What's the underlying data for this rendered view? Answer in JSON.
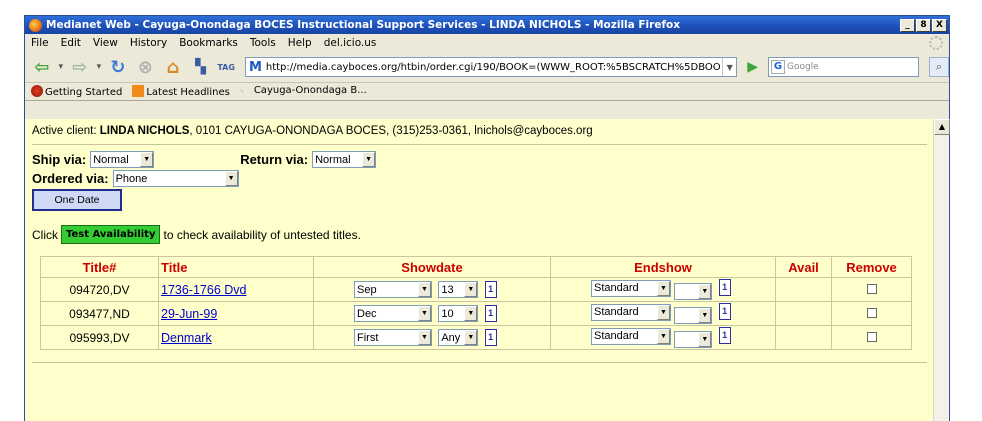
{
  "window": {
    "title": "Medianet Web - Cayuga-Onondaga BOCES Instructional Support Services - LINDA NICHOLS - Mozilla Firefox",
    "controls": [
      "_",
      "8",
      "X"
    ]
  },
  "menu": [
    "File",
    "Edit",
    "View",
    "History",
    "Bookmarks",
    "Tools",
    "Help",
    "del.icio.us"
  ],
  "nav": {
    "tag_label": "TAG",
    "url": "http://media.cayboces.org/htbin/order.cgi/190/BOOK=(WWW_ROOT:%5BSCRATCH%5DBOO",
    "search_placeholder": "Google"
  },
  "bookmarks": [
    "Getting Started",
    "Latest Headlines",
    "Cayuga-Onondaga B..."
  ],
  "client": {
    "prefix": "Active client: ",
    "name": "LINDA NICHOLS",
    "details": ", 0101 CAYUGA-ONONDAGA BOCES, (315)253-0361, lnichols@cayboces.org"
  },
  "form": {
    "ship_label": "Ship via:",
    "ship_value": "Normal",
    "return_label": "Return via:",
    "return_value": "Normal",
    "ordered_label": "Ordered via:",
    "ordered_value": "Phone",
    "one_date_button": "One Date",
    "click_prefix": "Click",
    "test_button": "Test Availability",
    "click_suffix": "to check availability of untested titles."
  },
  "table": {
    "headers": [
      "Title#",
      "Title",
      "Showdate",
      "Endshow",
      "Avail",
      "Remove"
    ],
    "rows": [
      {
        "num": "094720,DV",
        "title": "1736-1766 Dvd",
        "show_month": "Sep",
        "show_day": "13",
        "end_type": "Standard",
        "end_extra": ""
      },
      {
        "num": "093477,ND",
        "title": "29-Jun-99",
        "show_month": "Dec",
        "show_day": "10",
        "end_type": "Standard",
        "end_extra": ""
      },
      {
        "num": "095993,DV",
        "title": "Denmark",
        "show_month": "First",
        "show_day": "Any",
        "end_type": "Standard",
        "end_extra": ""
      }
    ]
  }
}
